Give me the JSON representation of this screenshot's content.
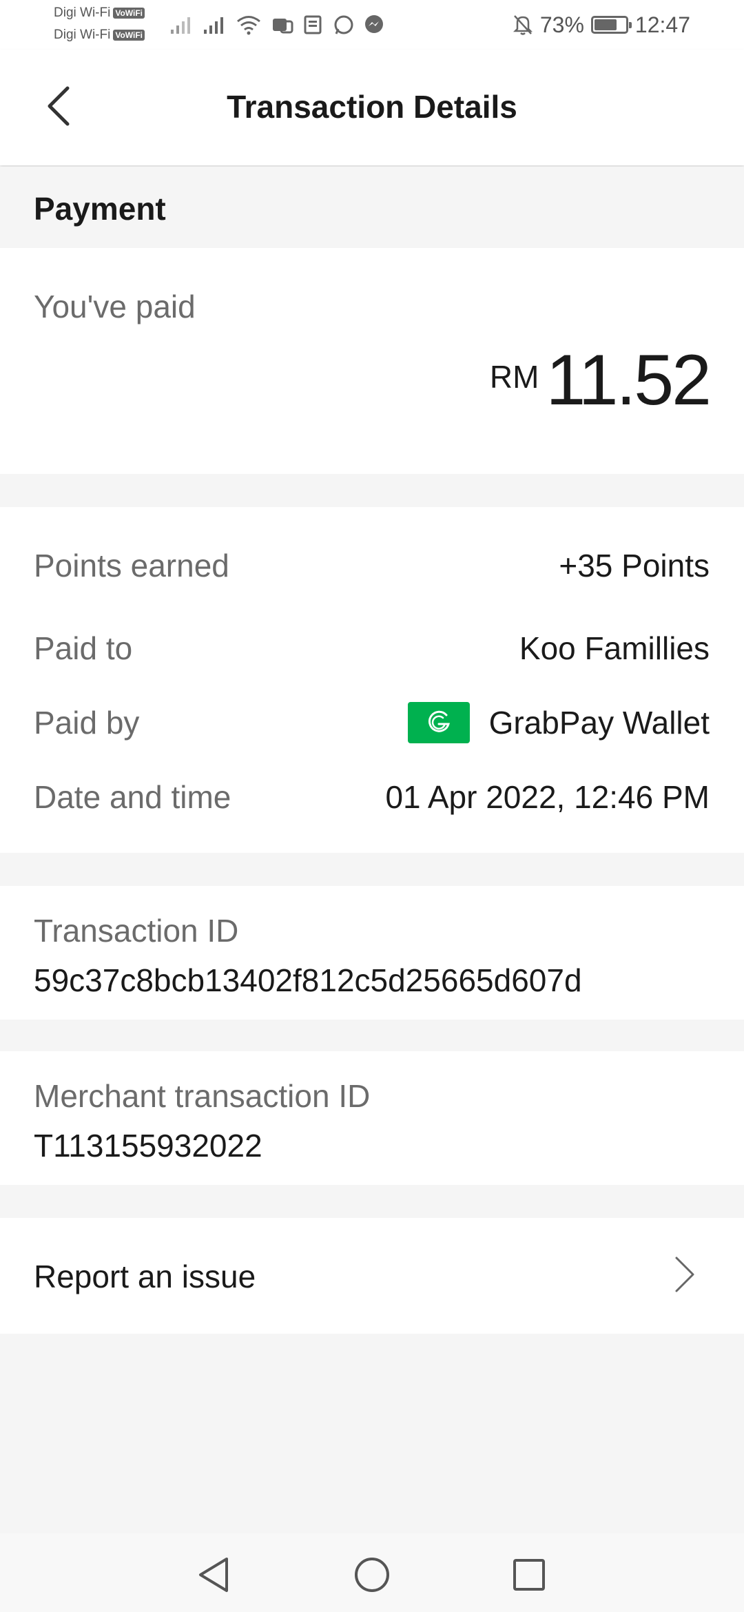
{
  "status_bar": {
    "carrier_1": "Digi Wi-Fi",
    "carrier_2": "Digi Wi-Fi",
    "volte_badge": "VoWiFi",
    "battery_percent": "73%",
    "battery_level": 0.73,
    "time": "12:47",
    "icons": [
      "signal-icon",
      "signal-icon",
      "wifi-icon",
      "notification-icon",
      "notification-icon",
      "whatsapp-icon",
      "messenger-icon",
      "bell-off-icon",
      "battery-icon"
    ]
  },
  "header": {
    "title": "Transaction Details",
    "back_icon": "chevron-left-icon"
  },
  "section": {
    "title": "Payment"
  },
  "payment": {
    "paid_label": "You've paid",
    "currency": "RM",
    "amount": "11.52"
  },
  "details": {
    "rows": [
      {
        "label": "Points earned",
        "value": "+35 Points"
      },
      {
        "label": "Paid to",
        "value": "Koo Famillies"
      },
      {
        "label": "Paid by",
        "value": "GrabPay Wallet",
        "icon": "grabpay-logo-icon"
      },
      {
        "label": "Date and time",
        "value": "01 Apr 2022, 12:46 PM"
      }
    ]
  },
  "transaction": {
    "label": "Transaction ID",
    "value": "59c37c8bcb13402f812c5d25665d607d"
  },
  "merchant": {
    "label": "Merchant transaction ID",
    "value": "T113155932022"
  },
  "report": {
    "label": "Report an issue",
    "icon": "chevron-right-icon"
  },
  "colors": {
    "background": "#f5f5f5",
    "card": "#ffffff",
    "text_primary": "#1a1a1a",
    "text_secondary": "#6b6b6b",
    "grab_green": "#00b14f"
  },
  "nav": {
    "icons": [
      "back-triangle-icon",
      "home-circle-icon",
      "recents-square-icon"
    ]
  }
}
